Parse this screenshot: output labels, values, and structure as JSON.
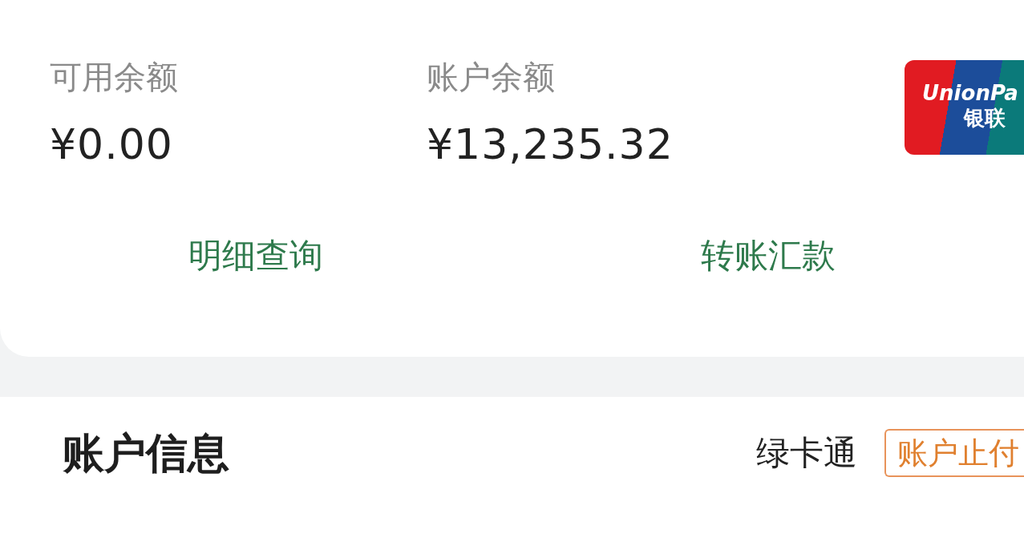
{
  "balances": [
    {
      "label": "可用余额",
      "amount": "¥0.00"
    },
    {
      "label": "账户余额",
      "amount": "¥13,235.32"
    }
  ],
  "card_logo": {
    "line_1": "UnionPa",
    "line_2": "银联"
  },
  "actions": [
    {
      "label": "明细查询"
    },
    {
      "label": "转账汇款"
    }
  ],
  "account_info": {
    "title": "账户信息",
    "card_type": "绿卡通",
    "status_badge": "账户止付"
  }
}
